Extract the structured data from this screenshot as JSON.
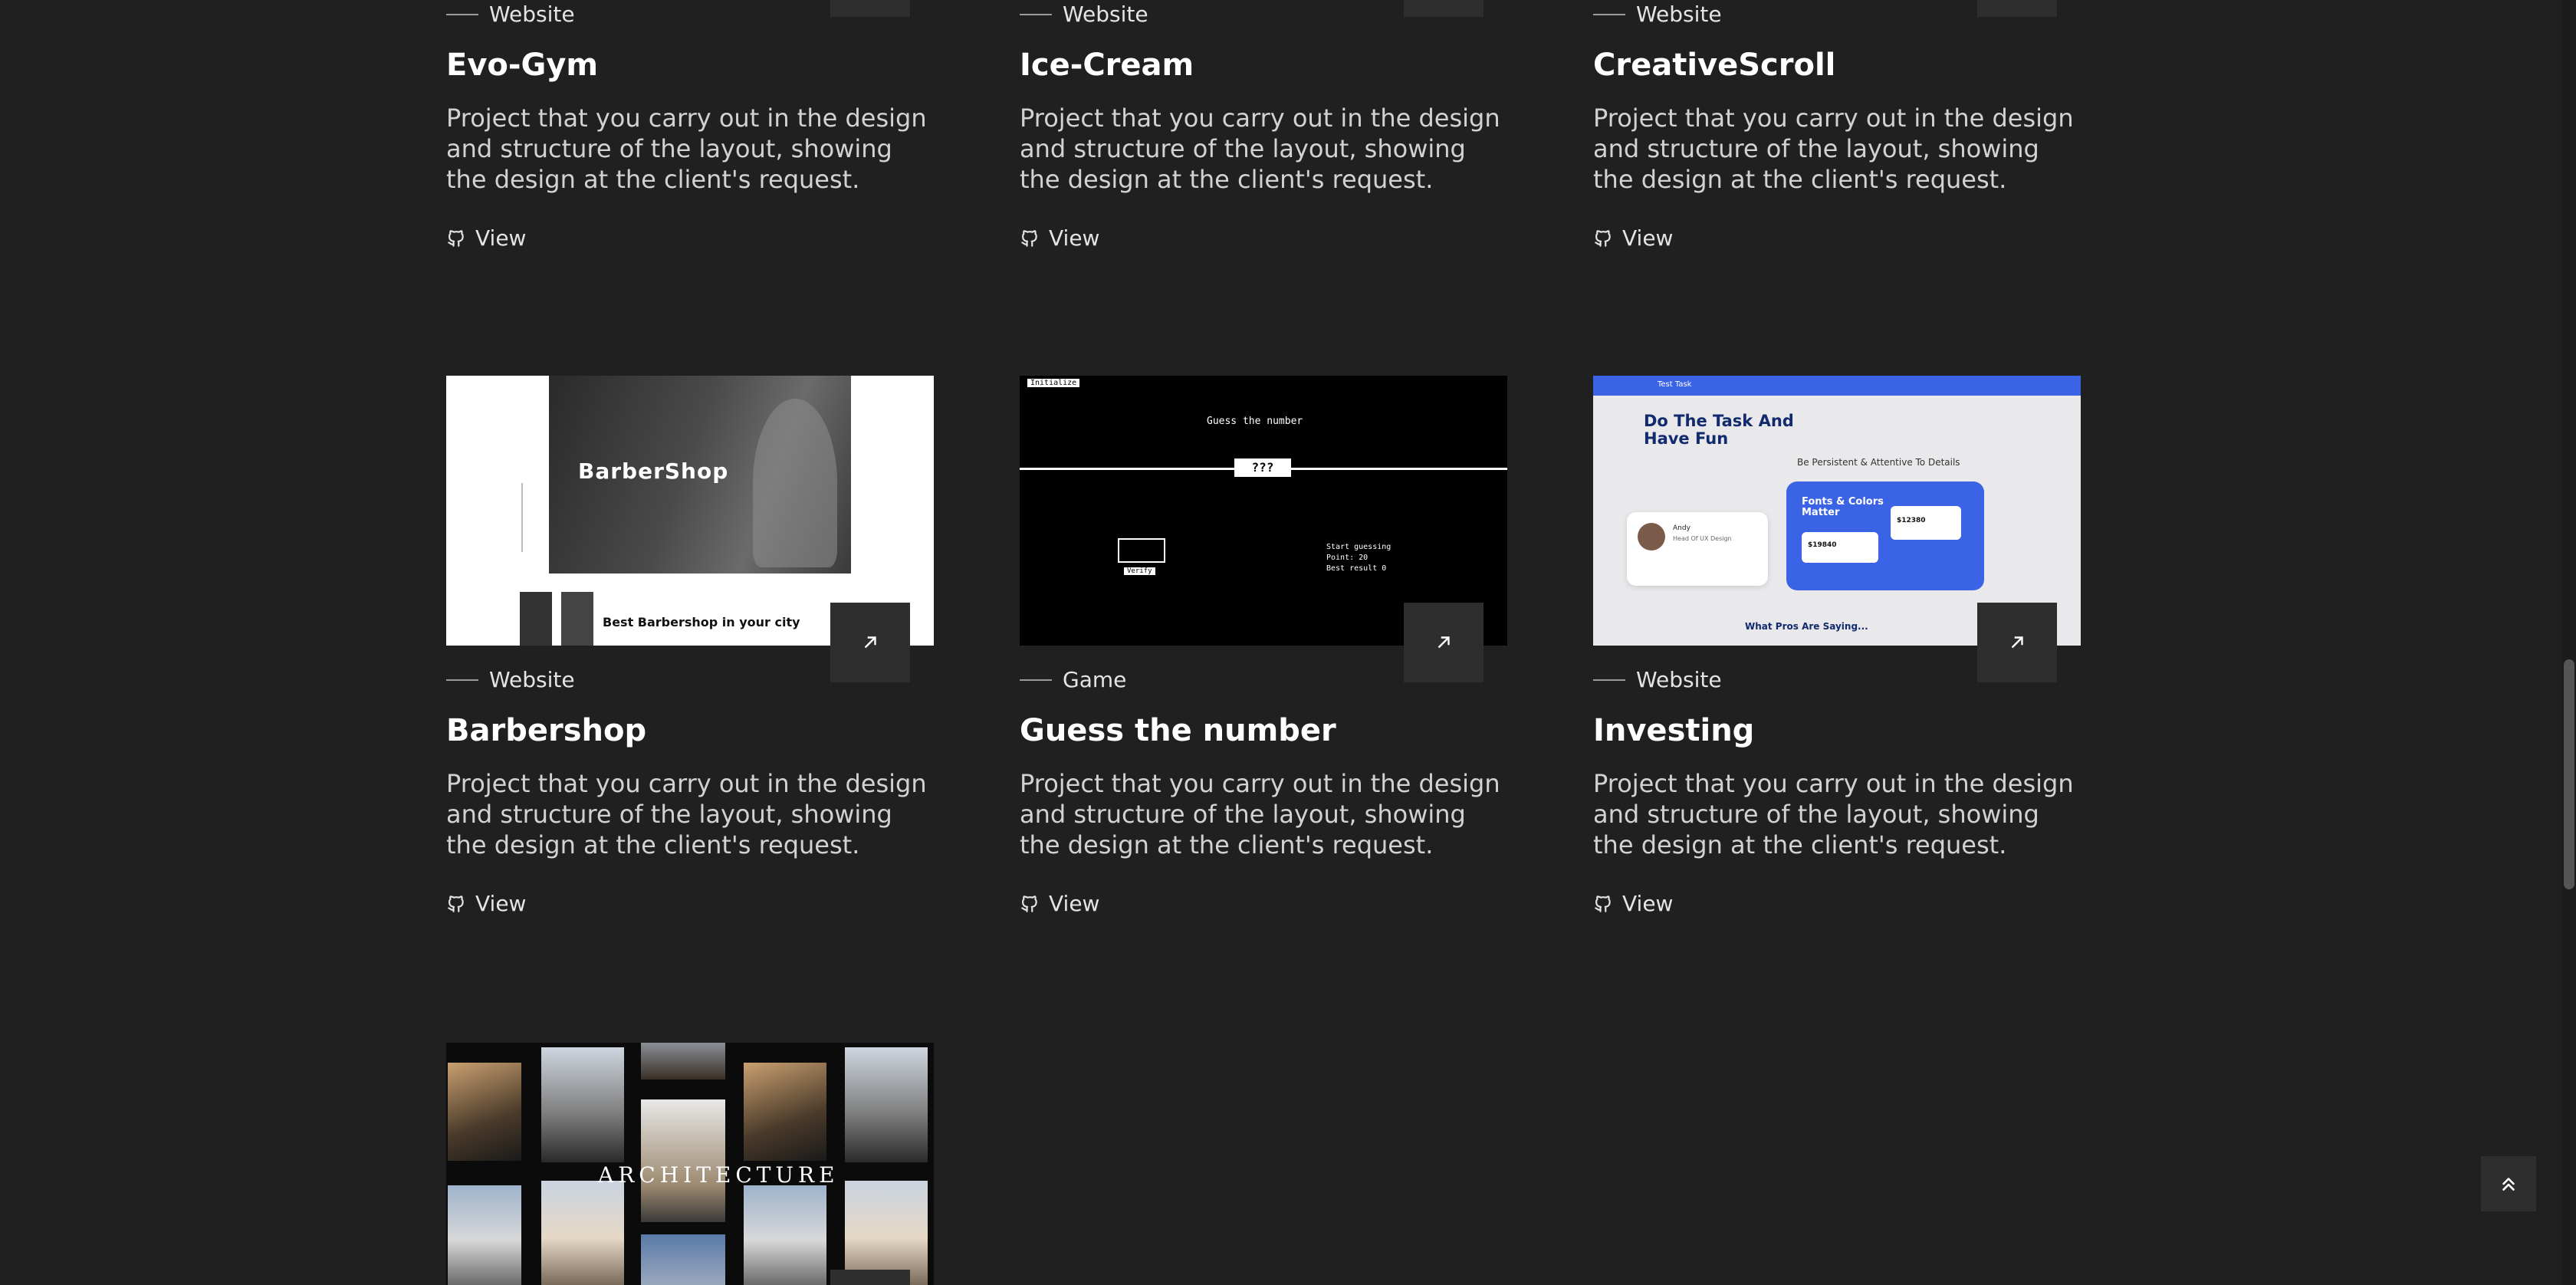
{
  "colors": {
    "background": "#202020",
    "card_button": "#2e2e2e",
    "text": "#ffffff",
    "muted": "#d2d2d2",
    "accent_blue": "#3b63e6"
  },
  "projects": [
    {
      "category": "Website",
      "title": "Evo-Gym",
      "description": "Project that you carry out in the design and structure of the layout, showing the design at the client's request.",
      "link_label": "View",
      "link_icon": "github-icon"
    },
    {
      "category": "Website",
      "title": "Ice-Cream",
      "description": "Project that you carry out in the design and structure of the layout, showing the design at the client's request.",
      "link_label": "View",
      "link_icon": "github-icon"
    },
    {
      "category": "Website",
      "title": "CreativeScroll",
      "description": "Project that you carry out in the design and structure of the layout, showing the design at the client's request.",
      "link_label": "View",
      "link_icon": "github-icon"
    },
    {
      "category": "Website",
      "title": "Barbershop",
      "description": "Project that you carry out in the design and structure of the layout, showing the design at the client's request.",
      "link_label": "View",
      "link_icon": "github-icon"
    },
    {
      "category": "Game",
      "title": "Guess the number",
      "description": "Project that you carry out in the design and structure of the layout, showing the design at the client's request.",
      "link_label": "View",
      "link_icon": "github-icon"
    },
    {
      "category": "Website",
      "title": "Investing",
      "description": "Project that you carry out in the design and structure of the layout, showing the design at the client's request.",
      "link_label": "View",
      "link_icon": "github-icon"
    }
  ],
  "thumbs": {
    "barbershop": {
      "hero_title": "BarberShop",
      "sub_title": "Best Barbershop in your city"
    },
    "guess": {
      "initialize": "Initialize",
      "heading": "Guess the number",
      "mystery": "???",
      "verify": "Verify",
      "start": "Start guessing",
      "points": "Point: 20",
      "best": "Best result 0"
    },
    "investing": {
      "brand": "Test Task",
      "headline": "Do The Task And Have Fun",
      "tagline": "Be Persistent & Attentive To Details",
      "panel_title": "Fonts & Colors Matter",
      "price1": "$12380",
      "price2": "$19840",
      "person_name": "Andy",
      "person_role": "Head Of UX Design",
      "footer": "What Pros Are Saying..."
    },
    "architecture": {
      "word": "ARCHITECTURE"
    }
  },
  "icons": {
    "open": "arrow-up-right-icon",
    "back_to_top": "double-chevron-up-icon"
  }
}
